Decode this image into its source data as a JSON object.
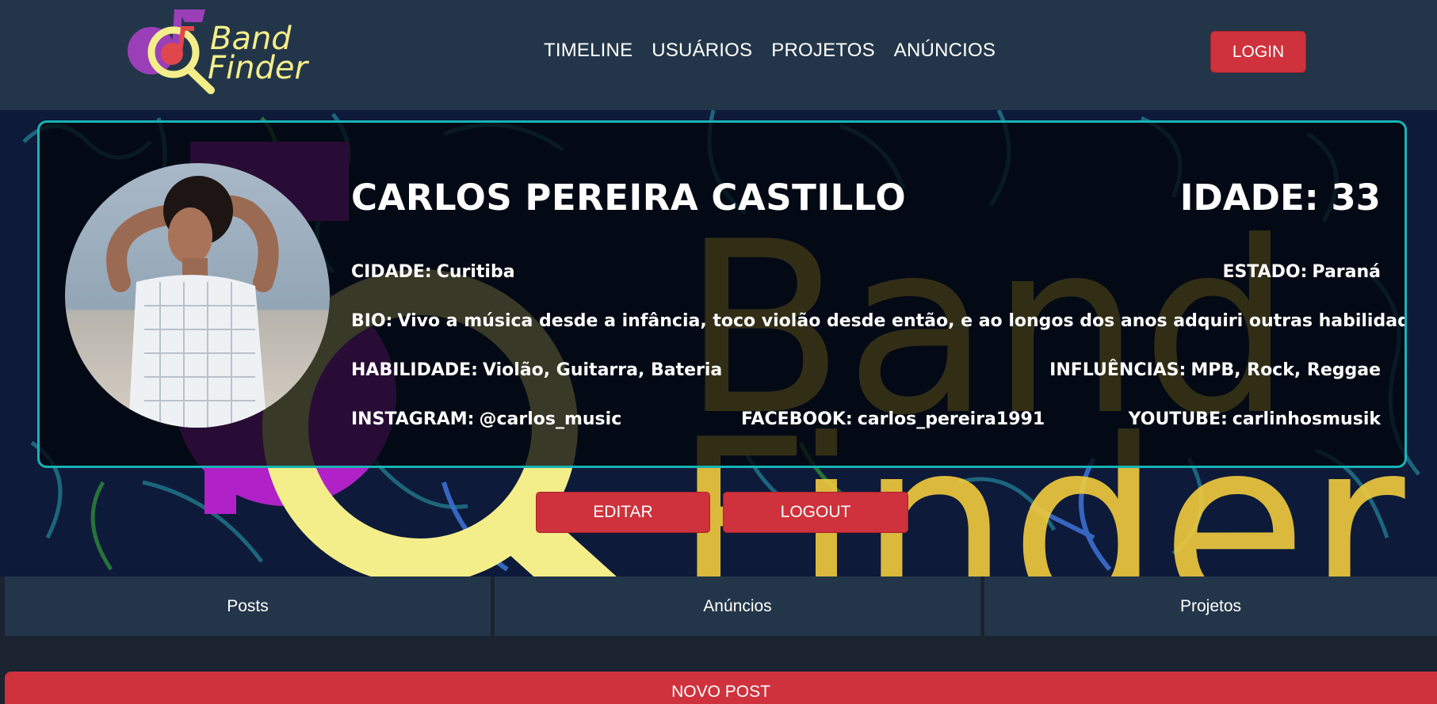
{
  "header": {
    "logo": {
      "line1": "Band",
      "line2": "Finder"
    },
    "nav": [
      "TIMELINE",
      "USUÁRIOS",
      "PROJETOS",
      "ANÚNCIOS"
    ],
    "login_label": "LOGIN"
  },
  "profile": {
    "name": "CARLOS PEREIRA CASTILLO",
    "age_label": "IDADE:",
    "age": "33",
    "cidade_label": "CIDADE:",
    "cidade": "Curitiba",
    "estado_label": "ESTADO:",
    "estado": "Paraná",
    "bio_label": "BIO:",
    "bio": "Vivo a música desde a infância, toco violão desde então, e ao longos dos anos adquiri outras habilidades",
    "habilidade_label": "HABILIDADE:",
    "habilidade": "Violão, Guitarra, Bateria",
    "influencias_label": "INFLUÊNCIAS:",
    "influencias": "MPB, Rock, Reggae",
    "instagram_label": "INSTAGRAM:",
    "instagram": "@carlos_music",
    "facebook_label": "FACEBOOK:",
    "facebook": "carlos_pereira1991",
    "youtube_label": "YOUTUBE:",
    "youtube": "carlinhosmusik"
  },
  "actions": {
    "edit_label": "EDITAR",
    "logout_label": "LOGOUT"
  },
  "tabs": [
    "Posts",
    "Anúncios",
    "Projetos"
  ],
  "new_post_label": "NOVO POST",
  "colors": {
    "header_bg": "#233649",
    "accent_red": "#cf323c",
    "card_border": "#19b3b5",
    "logo_purple": "#9b3fb8",
    "logo_yellow": "#f4ee8a",
    "logo_red": "#e0474c"
  }
}
